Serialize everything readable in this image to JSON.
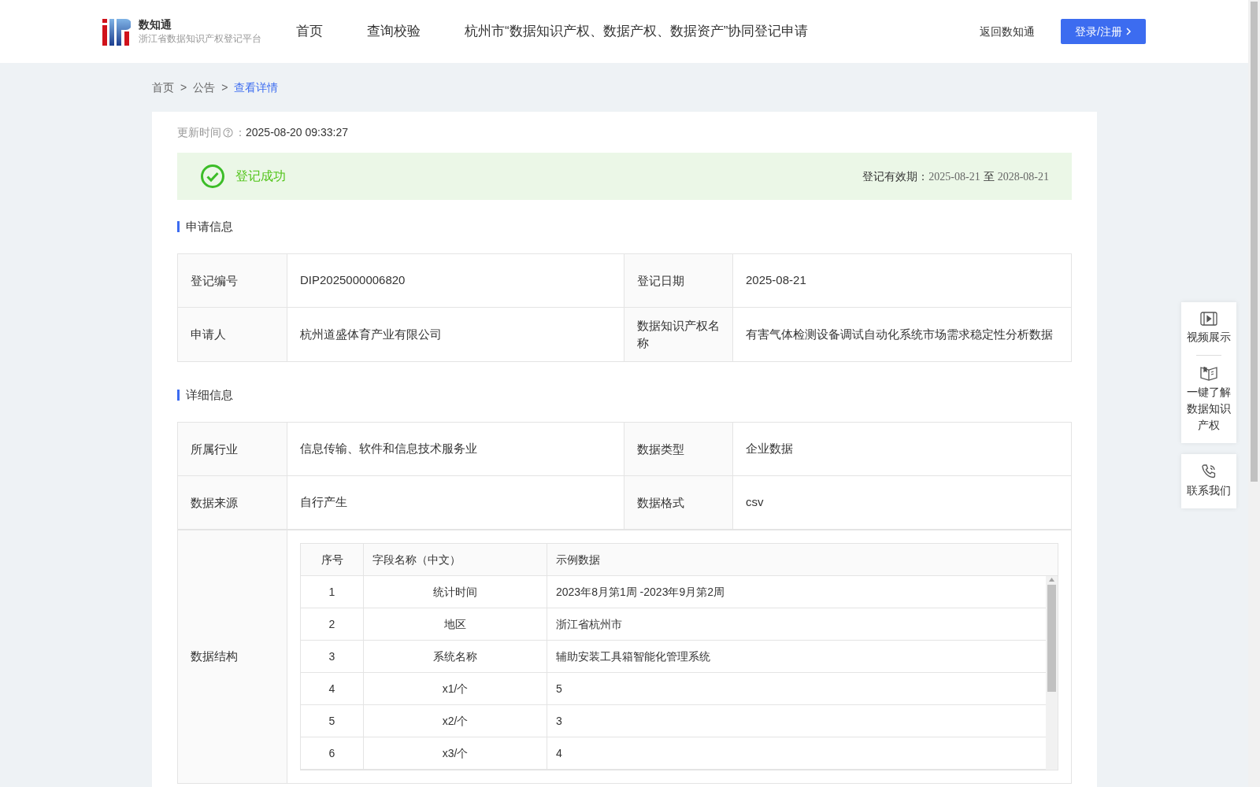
{
  "header": {
    "logo": {
      "title": "数知通",
      "subtitle": "浙江省数据知识产权登记平台"
    },
    "nav": [
      {
        "label": "首页",
        "selected": false
      },
      {
        "label": "查询校验",
        "selected": false
      },
      {
        "label": "杭州市“数据知识产权、数据产权、数据资产”协同登记申请",
        "selected": false
      }
    ],
    "back_link": "返回数知通",
    "login_button": "登录/注册"
  },
  "breadcrumb": [
    {
      "label": "首页",
      "current": false
    },
    {
      "label": "公告",
      "current": false
    },
    {
      "label": "查看详情",
      "current": true
    }
  ],
  "breadcrumb_separator": ">",
  "updated": {
    "label": "更新时间",
    "colon": "：",
    "value": "2025-08-20 09:33:27"
  },
  "status": {
    "text": "登记成功",
    "validity_label": "登记有效期：",
    "validity_from": "2025-08-21",
    "validity_sep": "至",
    "validity_to": "2028-08-21"
  },
  "application": {
    "title": "申请信息",
    "rows": [
      [
        {
          "label": "登记编号",
          "value": "DIP2025000006820"
        },
        {
          "label": "登记日期",
          "value": "2025-08-21"
        }
      ],
      [
        {
          "label": "申请人",
          "value": "杭州道盛体育产业有限公司"
        },
        {
          "label": "数据知识产权名称",
          "value": "有害气体检测设备调试自动化系统市场需求稳定性分析数据"
        }
      ]
    ]
  },
  "details": {
    "title": "详细信息",
    "rows": [
      [
        {
          "label": "所属行业",
          "value": "信息传输、软件和信息技术服务业"
        },
        {
          "label": "数据类型",
          "value": "企业数据"
        }
      ],
      [
        {
          "label": "数据来源",
          "value": "自行产生"
        },
        {
          "label": "数据格式",
          "value": "csv"
        }
      ]
    ],
    "structure": {
      "label": "数据结构",
      "columns": [
        "序号",
        "字段名称（中文）",
        "示例数据"
      ],
      "rows": [
        [
          "1",
          "统计时间",
          "2023年8月第1周 -2023年9月第2周"
        ],
        [
          "2",
          "地区",
          "浙江省杭州市"
        ],
        [
          "3",
          "系统名称",
          "辅助安装工具箱智能化管理系统"
        ],
        [
          "4",
          "x1/个",
          "5"
        ],
        [
          "5",
          "x2/个",
          "3"
        ],
        [
          "6",
          "x3/个",
          "4"
        ]
      ]
    }
  },
  "float_panel": [
    {
      "kind": "video",
      "label": "视频展示"
    },
    {
      "kind": "book",
      "label": "一键了解数据知识产权"
    },
    {
      "kind": "phone",
      "label": "联系我们"
    }
  ]
}
